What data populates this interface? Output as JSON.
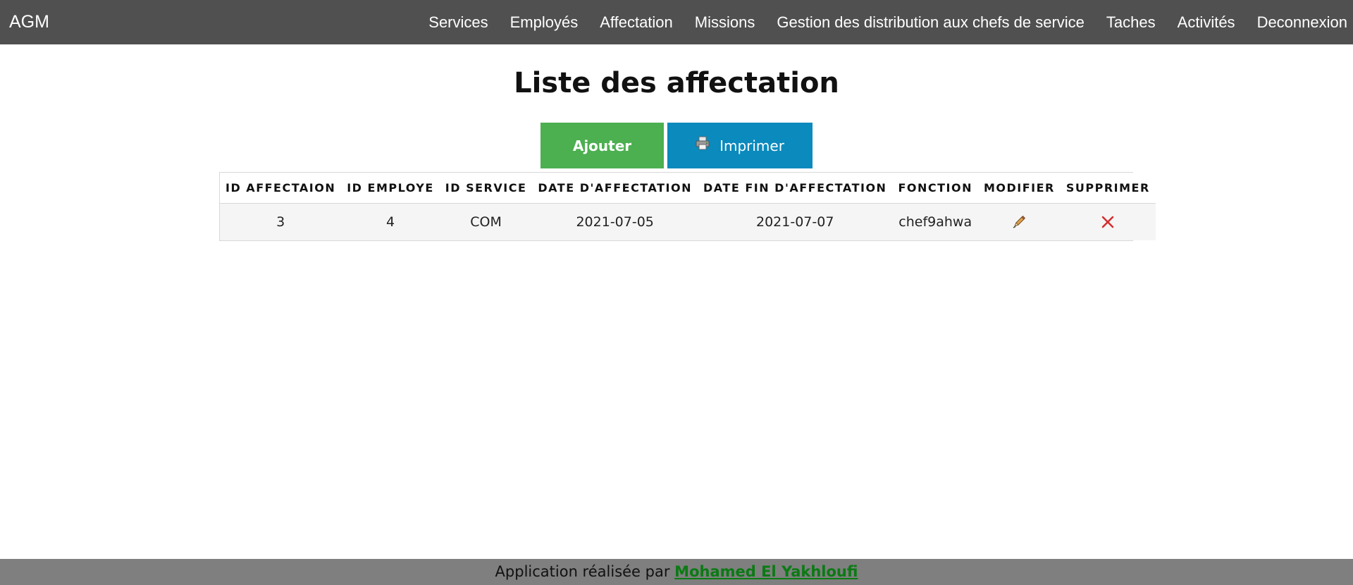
{
  "navbar": {
    "brand": "AGM",
    "links": [
      "Services",
      "Employés",
      "Affectation",
      "Missions",
      "Gestion des distribution aux chefs de service",
      "Taches",
      "Activités",
      "Deconnexion"
    ]
  },
  "page": {
    "title": "Liste des affectation"
  },
  "toolbar": {
    "add_label": "Ajouter",
    "print_label": "Imprimer",
    "print_icon": "printer-icon"
  },
  "table": {
    "headers": [
      "ID AFFECTAION",
      "ID EMPLOYE",
      "ID SERVICE",
      "DATE D'AFFECTATION",
      "DATE FIN D'AFFECTATION",
      "FONCTION",
      "MODIFIER",
      "SUPPRIMER"
    ],
    "rows": [
      {
        "id_affectation": "3",
        "id_employe": "4",
        "id_service": "COM",
        "date_affectation": "2021-07-05",
        "date_fin": "2021-07-07",
        "fonction": "chef9ahwa",
        "modify_icon": "pencil-icon",
        "delete_icon": "close-icon"
      }
    ]
  },
  "footer": {
    "text": "Application réalisée par",
    "author": "Mohamed El Yakhloufi"
  },
  "colors": {
    "navbar_bg": "#505050",
    "add_button": "#4caf50",
    "print_button": "#0a8abd",
    "footer_bg": "#7f7f7f",
    "author_link": "#0b7a14",
    "delete_icon": "#d32f2f"
  }
}
